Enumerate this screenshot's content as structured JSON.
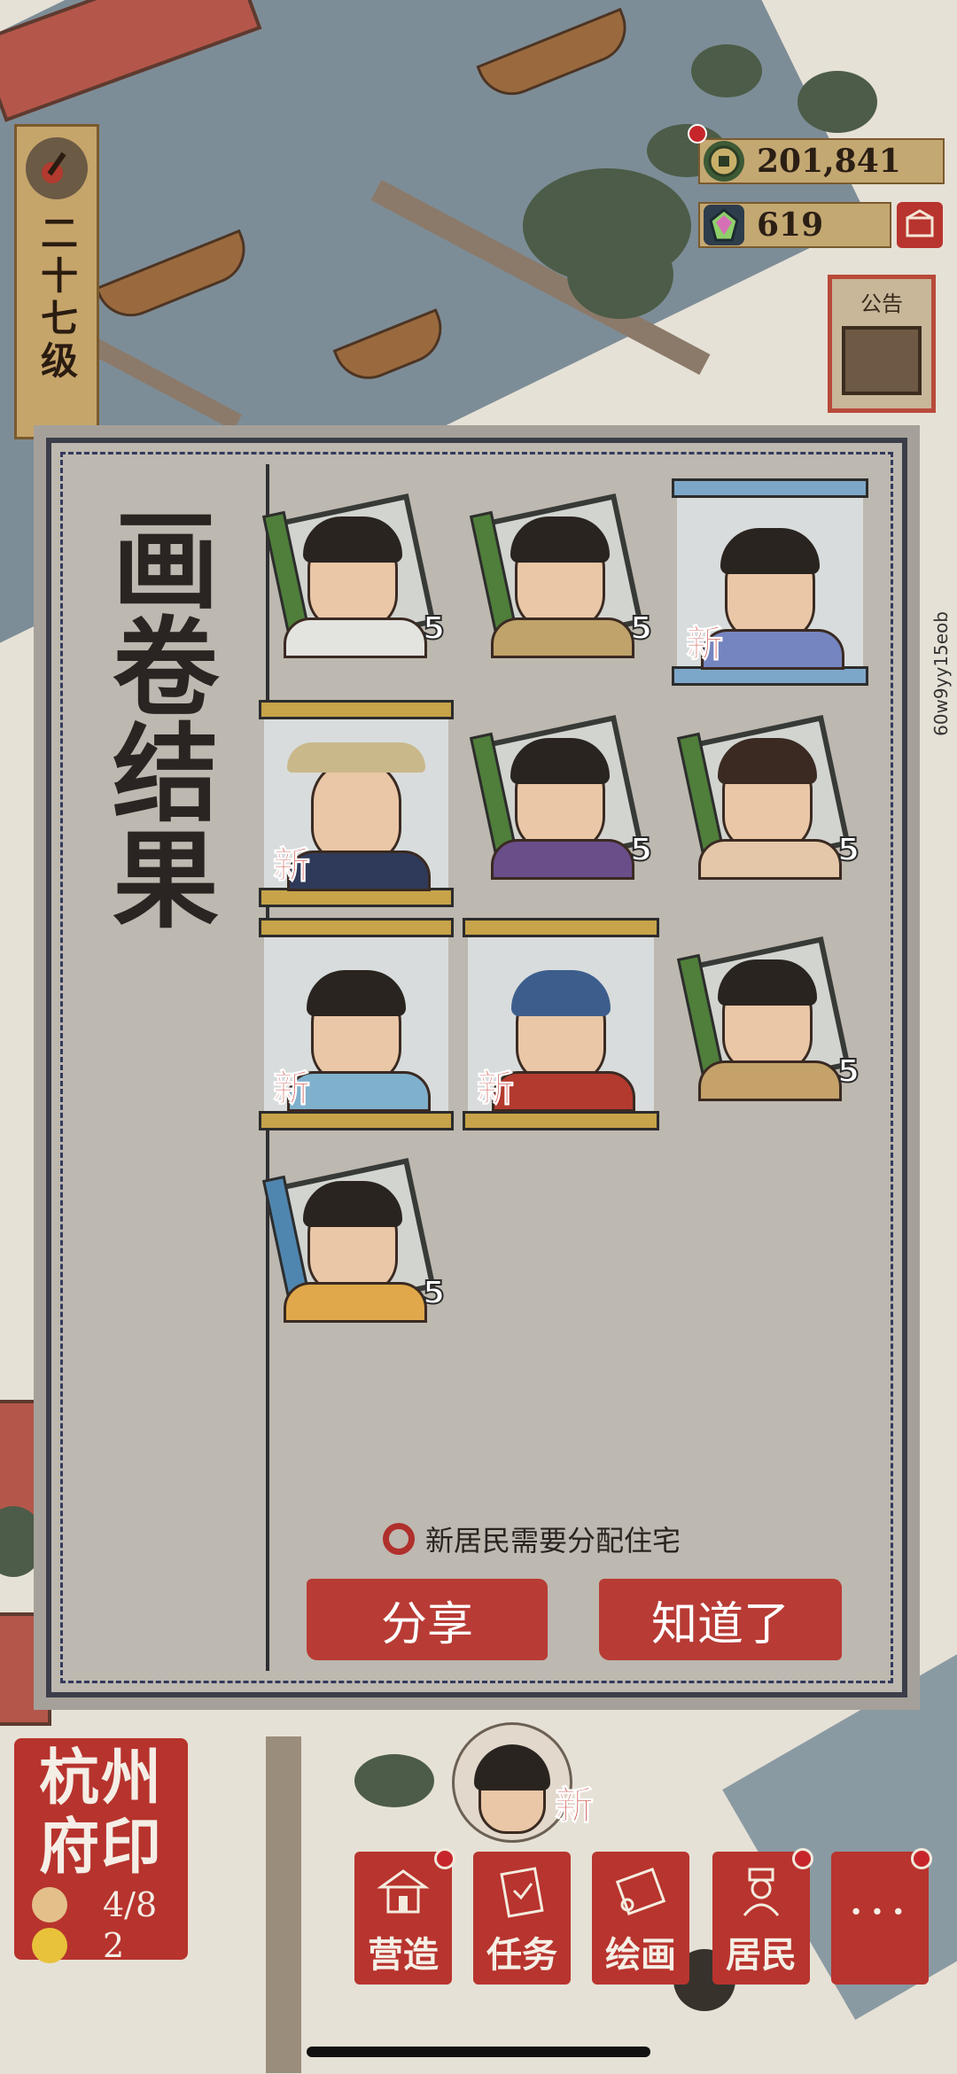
{
  "level": {
    "text": "二十七级"
  },
  "currency": {
    "coins": "201,841",
    "gems": "619"
  },
  "notice": {
    "label": "公告"
  },
  "side_id": "60w9yy15eob",
  "dialog": {
    "title": "画卷结果",
    "cards": [
      {
        "name": "portrait-1",
        "badge": "5",
        "is_new": false
      },
      {
        "name": "portrait-2",
        "badge": "5",
        "is_new": false
      },
      {
        "name": "portrait-3",
        "badge": "新",
        "is_new": true
      },
      {
        "name": "portrait-4",
        "badge": "新",
        "is_new": true
      },
      {
        "name": "portrait-5",
        "badge": "5",
        "is_new": false
      },
      {
        "name": "portrait-6",
        "badge": "5",
        "is_new": false
      },
      {
        "name": "portrait-7",
        "badge": "新",
        "is_new": true
      },
      {
        "name": "portrait-8",
        "badge": "新",
        "is_new": true
      },
      {
        "name": "portrait-9",
        "badge": "5",
        "is_new": false
      },
      {
        "name": "portrait-10",
        "badge": "5",
        "is_new": false
      }
    ],
    "note": "新居民需要分配住宅",
    "share_label": "分享",
    "ok_label": "知道了"
  },
  "seal": {
    "title": "杭州府印",
    "residents": "4/8",
    "happy": "2"
  },
  "new_resident_tag": "新",
  "menu": [
    {
      "label": "营造",
      "icon": "building-icon",
      "dot": true
    },
    {
      "label": "任务",
      "icon": "task-book-icon",
      "dot": false
    },
    {
      "label": "绘画",
      "icon": "scroll-icon",
      "dot": false
    },
    {
      "label": "居民",
      "icon": "resident-icon",
      "dot": true
    },
    {
      "label": "···",
      "icon": "more-icon",
      "dot": true
    }
  ],
  "colors": {
    "button_red": "#b83b35",
    "new_red": "#c33a32",
    "panel_gray": "#bdb8b0"
  }
}
